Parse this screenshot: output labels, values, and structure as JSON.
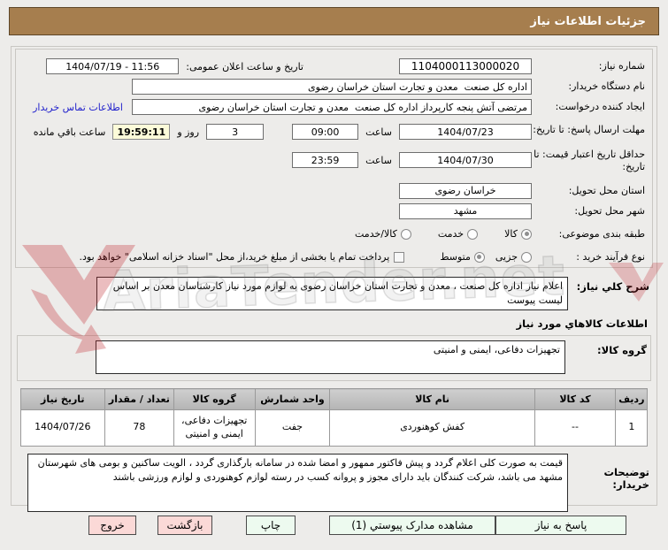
{
  "title_bar": {
    "text": "جزئیات اطلاعات نیاز"
  },
  "form": {
    "need_number": {
      "label": "شماره نیاز:",
      "value": "1104000113000020"
    },
    "announce": {
      "label": "تاریخ و ساعت اعلان عمومی:",
      "value": "1404/07/19 - 11:56"
    },
    "buyer_org": {
      "label": "نام دستگاه خریدار:",
      "value": "اداره کل صنعت  معدن و تجارت استان خراسان رضوی"
    },
    "request_creator": {
      "label": "ایجاد کننده درخواست:",
      "value": "مرتضی آتش پنجه کارپرداز اداره کل صنعت  معدن و تجارت استان خراسان رضوی",
      "contact_link": "اطلاعات تماس خریدار"
    },
    "reply_deadline": {
      "label": "مهلت ارسال پاسخ: تا تاریخ:",
      "date": "1404/07/23",
      "hour_label": "ساعت",
      "hour": "09:00",
      "days": "3",
      "days_label": "روز و",
      "remaining": "19:59:11",
      "remaining_label": "ساعت باقي مانده"
    },
    "price_validity": {
      "label": "حداقل تاریخ اعتبار قیمت: تا تاریخ:",
      "date": "1404/07/30",
      "hour_label": "ساعت",
      "hour": "23:59"
    },
    "delivery_province": {
      "label": "استان محل تحویل:",
      "value": "خراسان رضوی"
    },
    "delivery_city": {
      "label": "شهر محل تحویل:",
      "value": "مشهد"
    },
    "subject_class": {
      "label": "طبقه بندی موضوعی:",
      "options": [
        {
          "label": "کالا",
          "selected": true
        },
        {
          "label": "خدمت",
          "selected": false
        },
        {
          "label": "کالا/خدمت",
          "selected": false
        }
      ]
    },
    "purchase_type": {
      "label": "نوع فرآیند خرید :",
      "options": [
        {
          "label": "جزیی",
          "selected": false
        },
        {
          "label": "متوسط",
          "selected": true
        }
      ],
      "treasury_checkbox_label": "پرداخت تمام یا بخشی از مبلغ خرید،از محل \"اسناد خزانه اسلامی\" خواهد بود.",
      "treasury_checked": false
    }
  },
  "need_description": {
    "label": "شرح کلي نياز:",
    "value": "اعلام نیاز اداره کل صنعت ، معدن و تجارت استان خراسان رضوی به لوازم مورد نیاز کارشناسان معدن بر اساس لیست پیوست"
  },
  "goods_section_title": "اطلاعات کالاهاي مورد نياز",
  "goods_group": {
    "label": "گروه کالا:",
    "value": "تجهیزات دفاعی، ایمنی و امنیتی"
  },
  "items_table": {
    "headers": [
      "ردیف",
      "کد کالا",
      "نام کالا",
      "واحد شمارش",
      "گروه کالا",
      "تعداد / مقدار",
      "تاریخ نیاز"
    ],
    "rows": [
      [
        "1",
        "--",
        "کفش کوهنوردی",
        "جفت",
        "تجهیزات دفاعی، ایمنی و امنیتی",
        "78",
        "1404/07/26"
      ]
    ]
  },
  "buyer_notes": {
    "label": "توضیحات خریدار:",
    "value": "قیمت به صورت کلی اعلام گردد و پیش فاکتور ممهور و امضا شده در سامانه بارگذاری گردد ، الویت ساکنین و بومی های شهرستان مشهد می باشد، شرکت کنندگان باید دارای مجوز و پروانه کسب در رسته لوازم کوهنوردی و لوازم ورزشی باشند"
  },
  "buttons": [
    {
      "label": "پاسخ به نیاز",
      "type": "green"
    },
    {
      "label": "مشاهده مدارک پیوستي (1)",
      "type": "green"
    },
    {
      "label": "چاپ",
      "type": "green"
    },
    {
      "label": "بازگشت",
      "type": "pink"
    },
    {
      "label": "خروج",
      "type": "pink"
    }
  ],
  "watermark": {
    "text": "AriaTender.net"
  },
  "colors": {
    "header_bg": "#A67E4E",
    "page_bg": "#EDECEA",
    "button_green": "#EDFAEF",
    "button_pink": "#FBD9D7",
    "link_blue": "#2222CC",
    "remaining_highlight": "#FCFBD9",
    "watermark_red": "#C0272D"
  }
}
